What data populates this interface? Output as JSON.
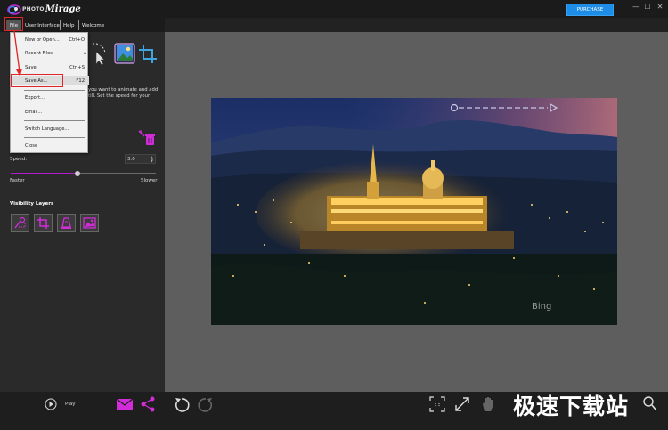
{
  "titlebar": {
    "brand_small": "PHOTO",
    "brand_large": "Mirage",
    "purchase_label": "PURCHASE",
    "minimize": "—",
    "maximize": "☐",
    "close": "✕"
  },
  "menubar": {
    "items": [
      {
        "label": "File"
      },
      {
        "label": "User Interface"
      },
      {
        "label": "Help"
      },
      {
        "label": "Welcome"
      }
    ]
  },
  "file_menu": {
    "items": [
      {
        "label": "New or Open...",
        "shortcut": "Ctrl+O"
      },
      {
        "label": "Recent Files",
        "shortcut": "▸"
      },
      {
        "label": "Save",
        "shortcut": "Ctrl+S"
      },
      {
        "label": "Save As...",
        "shortcut": "F12"
      },
      {
        "label": "Export..."
      },
      {
        "label": "Email..."
      },
      {
        "label": "Switch Language..."
      },
      {
        "label": "Close"
      }
    ]
  },
  "left_panel": {
    "instruction": "you want to animate and add till. Set the speed for your",
    "instruction_lines": [
      "you want to animate and add",
      "till. Set the speed for your"
    ],
    "speed_label": "Speed:",
    "speed_value": "3.0",
    "speed_fraction": 0.46,
    "faster_label": "Faster",
    "slower_label": "Slower",
    "visibility_title": "Visibility Layers",
    "visibility_icons": [
      "mask-brush-icon",
      "crop-icon",
      "erase-icon",
      "image-icon"
    ]
  },
  "canvas": {
    "watermark_text": "Bing"
  },
  "bottom": {
    "play_label": "Play",
    "site_watermark": "极速下载站"
  },
  "colors": {
    "accent": "#b31bd1",
    "purchase": "#1d8de8",
    "highlight": "#e02626",
    "canvas_bg": "#5e5e5e",
    "panel_bg": "#2a2a2a"
  }
}
